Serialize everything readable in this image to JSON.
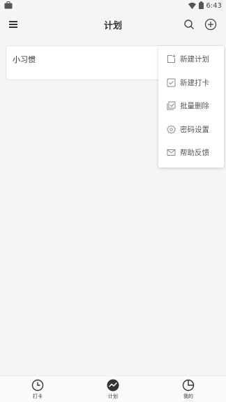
{
  "status_bar": {
    "time": "6:43"
  },
  "app_bar": {
    "title": "计划"
  },
  "plans": [
    {
      "title": "小习惯"
    }
  ],
  "dropdown_menu": {
    "items": [
      {
        "label": "新建计划",
        "icon": "new-plan-icon"
      },
      {
        "label": "新建打卡",
        "icon": "checkbox-icon"
      },
      {
        "label": "批量删除",
        "icon": "batch-delete-icon"
      },
      {
        "label": "密码设置",
        "icon": "gear-icon"
      },
      {
        "label": "帮助反馈",
        "icon": "mail-icon"
      }
    ]
  },
  "bottom_nav": {
    "items": [
      {
        "label": "打卡",
        "icon": "clock-icon",
        "active": false
      },
      {
        "label": "计划",
        "icon": "trend-icon",
        "active": true
      },
      {
        "label": "我的",
        "icon": "pie-icon",
        "active": false
      }
    ]
  },
  "colors": {
    "background": "#f5f5f5",
    "text": "#333333",
    "icon": "#444444"
  }
}
